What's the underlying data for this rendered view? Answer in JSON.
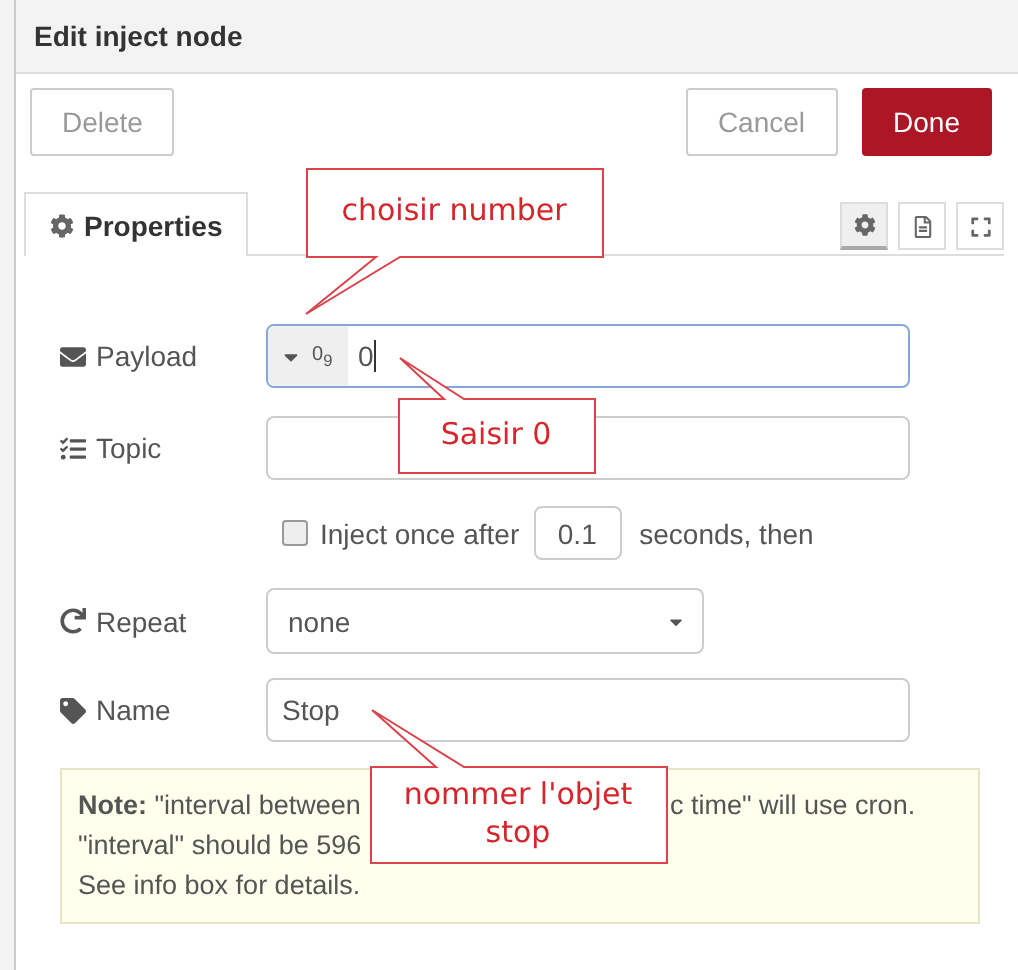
{
  "title": "Edit inject node",
  "buttons": {
    "delete": "Delete",
    "cancel": "Cancel",
    "done": "Done"
  },
  "tabs": [
    {
      "label": "Properties",
      "selected": true
    }
  ],
  "tab_tools": [
    {
      "kind": "settings",
      "selected": true
    },
    {
      "kind": "description",
      "selected": false
    },
    {
      "kind": "appearance",
      "selected": false
    }
  ],
  "payload": {
    "label": "Payload",
    "type_icon": "0",
    "type_sub": "9",
    "value": "0"
  },
  "topic": {
    "label": "Topic"
  },
  "inject_once": {
    "checked": false,
    "label": "Inject once after",
    "value": "0.1",
    "suffix": "seconds, then"
  },
  "repeat": {
    "label": "Repeat",
    "value": "none"
  },
  "name": {
    "label": "Name",
    "value": "Stop"
  },
  "note": {
    "lines": [
      [
        "**Note:** \"interval between",
        "c time\" will use cron."
      ],
      [
        "\"interval\" should be 596"
      ],
      [
        "See info box for details."
      ]
    ]
  },
  "callouts": [
    {
      "text": "choisir number"
    },
    {
      "text": "Saisir 0"
    },
    {
      "text": "nommer l'objet stop"
    }
  ]
}
